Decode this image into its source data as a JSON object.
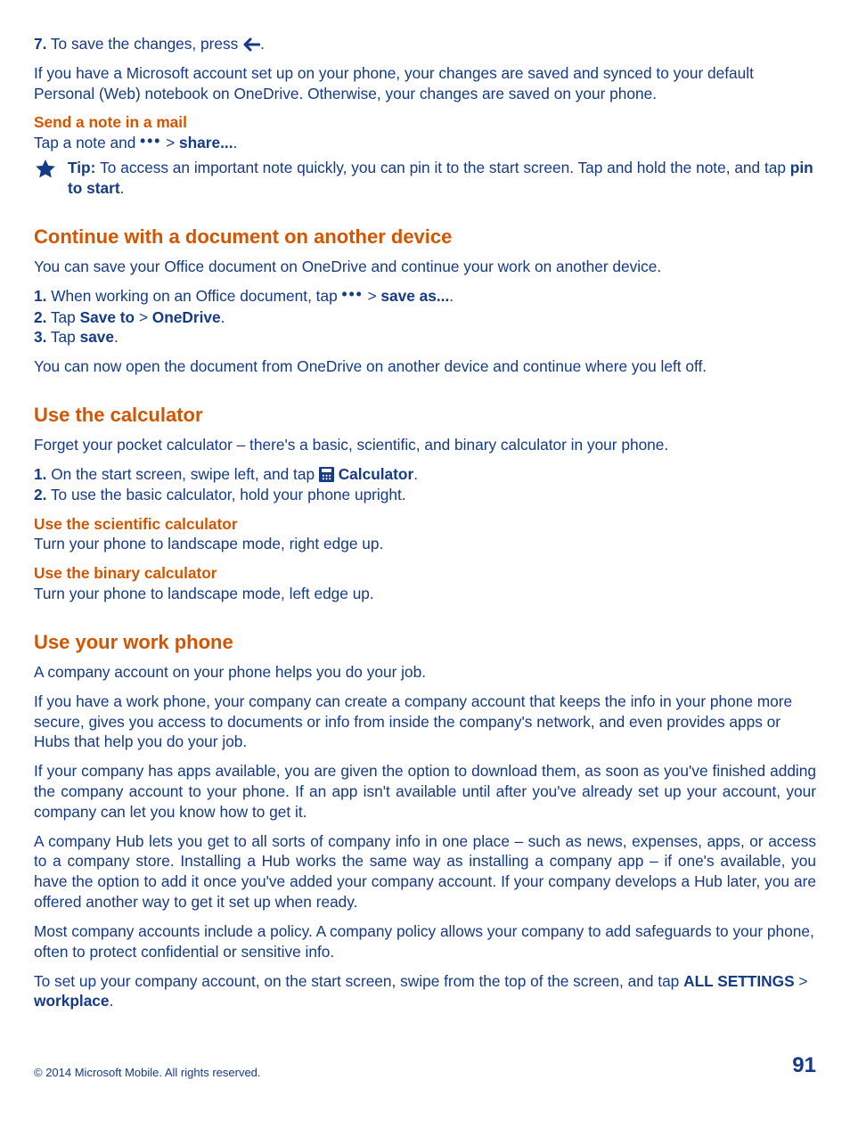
{
  "step7_prefix_num": "7.",
  "step7_prefix_text": " To save the changes, press ",
  "step7_suffix": ".",
  "ms_account_para": "If you have a Microsoft account set up on your phone, your changes are saved and synced to your default Personal (Web) notebook on OneDrive. Otherwise, your changes are saved on your phone.",
  "send_note_heading": "Send a note in a mail",
  "send_note_tap_pre": "Tap a note and  ",
  "send_note_gt": "  > ",
  "send_note_share": "share...",
  "send_note_dot": ".",
  "tip_label": "Tip: ",
  "tip_text_a": "To access an important note quickly, you can pin it to the start screen. Tap and hold the note, and tap ",
  "tip_pin": "pin to start",
  "tip_text_b": ".",
  "h_continue": "Continue with a document on another device",
  "continue_intro": "You can save your Office document on OneDrive and continue your work on another device.",
  "cont_s1_num": "1.",
  "cont_s1_a": " When working on an Office document, tap  ",
  "cont_s1_gt": "  > ",
  "cont_s1_saveas": "save as...",
  "cont_s1_dot": ".",
  "cont_s2_num": "2.",
  "cont_s2_a": " Tap ",
  "cont_s2_saveto": "Save to",
  "cont_s2_gt": " > ",
  "cont_s2_onedrive": "OneDrive",
  "cont_s2_dot": ".",
  "cont_s3_num": "3.",
  "cont_s3_a": " Tap ",
  "cont_s3_save": "save",
  "cont_s3_dot": ".",
  "continue_out": "You can now open the document from OneDrive on another device and continue where you left off.",
  "h_calc": "Use the calculator",
  "calc_intro": "Forget your pocket calculator – there's a basic, scientific, and binary calculator in your phone.",
  "calc_s1_num": "1.",
  "calc_s1_a": " On the start screen, swipe left, and tap ",
  "calc_s1_app": " Calculator",
  "calc_s1_dot": ".",
  "calc_s2_num": "2.",
  "calc_s2_a": " To use the basic calculator, hold your phone upright.",
  "sci_head": "Use the scientific calculator",
  "sci_body": "Turn your phone to landscape mode, right edge up.",
  "bin_head": "Use the binary calculator",
  "bin_body": "Turn your phone to landscape mode, left edge up.",
  "h_work": "Use your work phone",
  "work_p1": "A company account on your phone helps you do your job.",
  "work_p2": "If you have a work phone, your company can create a company account that keeps the info in your phone more secure, gives you access to documents or info from inside the company's network, and even provides apps or Hubs that help you do your job.",
  "work_p3": "If your company has apps available, you are given the option to download them, as soon as you've finished adding the company account to your phone. If an app isn't available until after you've already set up your account, your company can let you know how to get it.",
  "work_p4": "A company Hub lets you get to all sorts of company info in one place – such as news, expenses, apps, or access to a company store. Installing a Hub works the same way as installing a company app – if one's available, you have the option to add it once you've added your company account. If your company develops a Hub later, you are offered another way to get it set up when ready.",
  "work_p5": "Most company accounts include a policy. A company policy allows your company to add safeguards to your phone, often to protect confidential or sensitive info.",
  "work_setup_a": "To set up your company account, on the start screen, swipe from the top of the screen, and tap ",
  "work_setup_all": "ALL SETTINGS",
  "work_setup_gt": " > ",
  "work_setup_wp": "workplace",
  "work_setup_dot": ".",
  "copyright": "© 2014 Microsoft Mobile. All rights reserved.",
  "page_number": "91"
}
